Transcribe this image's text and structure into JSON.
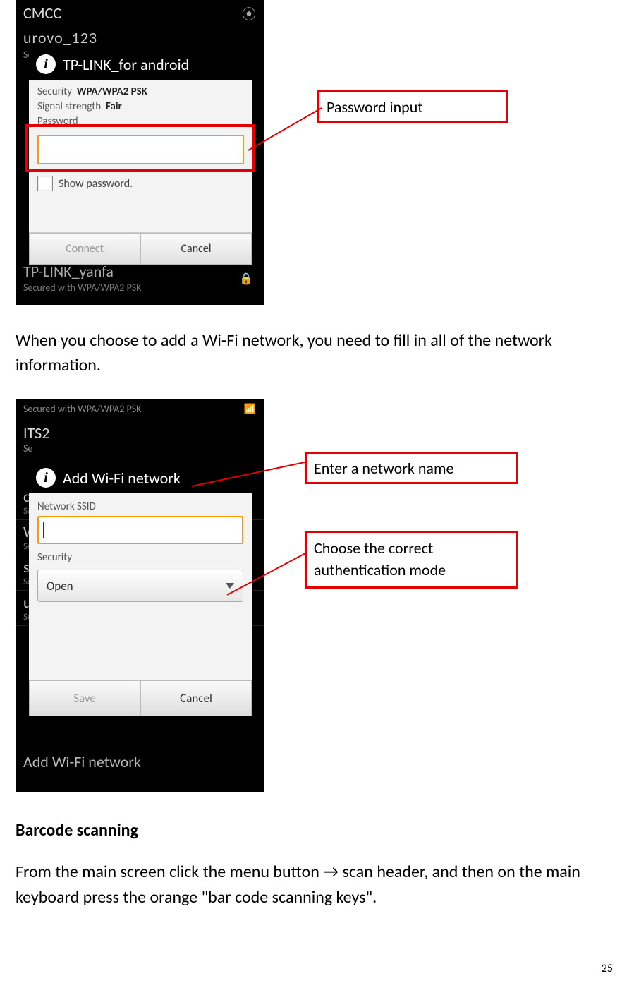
{
  "page_number": "25",
  "screenshot1": {
    "bg_top": "CMCC",
    "bg_urovo": "urovo_123",
    "bg_urovo_sub": "Se",
    "dialog_title": "TP-LINK_for android",
    "security_label": "Security",
    "security_value": "WPA/WPA2 PSK",
    "signal_label": "Signal strength",
    "signal_value": "Fair",
    "password_label": "Password",
    "show_password": "Show password.",
    "connect": "Connect",
    "cancel": "Cancel",
    "bg_yanfa": "TP-LINK_yanfa",
    "bg_yanfa_sub": "Secured with WPA/WPA2 PSK"
  },
  "callout1": "Password input",
  "paragraph1": "When you choose to add a Wi-Fi network, you need to fill in all of the network information.",
  "screenshot2": {
    "bg_top_sub": "Secured with WPA/WPA2 PSK",
    "bg_its": "ITS2",
    "bg_its_sub": "Se",
    "dialog_title": "Add Wi-Fi network",
    "ssid_label": "Network SSID",
    "security_label": "Security",
    "security_value": "Open",
    "save": "Save",
    "cancel": "Cancel",
    "bg_add": "Add Wi-Fi network",
    "bg_rows": [
      {
        "name": "cl",
        "sub": "Se"
      },
      {
        "name": "W",
        "sub": "Se"
      },
      {
        "name": "su",
        "sub": "Se"
      },
      {
        "name": "u",
        "sub": "Se"
      }
    ]
  },
  "callout2a": "Enter a network name",
  "callout2b": "Choose the correct authentication mode",
  "heading2": "Barcode scanning",
  "paragraph2": "From the main screen click the menu button → scan header, and then on the main keyboard press the orange \"bar code scanning keys\"."
}
